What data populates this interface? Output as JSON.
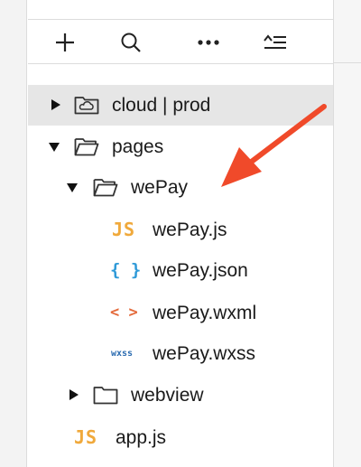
{
  "toolbar": {
    "buttons": [
      {
        "name": "add-icon"
      },
      {
        "name": "search-icon"
      },
      {
        "name": "more-icon"
      },
      {
        "name": "collapse-icon"
      }
    ]
  },
  "tree": {
    "items": [
      {
        "label": "cloud | prod",
        "type": "cloud-folder",
        "expanded": false,
        "selected": true
      },
      {
        "label": "pages",
        "type": "folder",
        "expanded": true
      },
      {
        "label": "wePay",
        "type": "folder",
        "expanded": true
      },
      {
        "label": "wePay.js",
        "type": "file",
        "icon_text": "JS",
        "icon_color": "#f0a93b"
      },
      {
        "label": "wePay.json",
        "type": "file",
        "icon_text": "{ }",
        "icon_color": "#2f9ad8"
      },
      {
        "label": "wePay.wxml",
        "type": "file",
        "icon_text": "< >",
        "icon_color": "#e46a3b"
      },
      {
        "label": "wePay.wxss",
        "type": "file",
        "icon_text": "wxss",
        "icon_color": "#2a6bb0"
      },
      {
        "label": "webview",
        "type": "folder",
        "expanded": false
      },
      {
        "label": "app.js",
        "type": "file",
        "icon_text": "JS",
        "icon_color": "#f0a93b"
      }
    ]
  },
  "annotation": {
    "color": "#f04a2a",
    "points_to": "wePay"
  }
}
